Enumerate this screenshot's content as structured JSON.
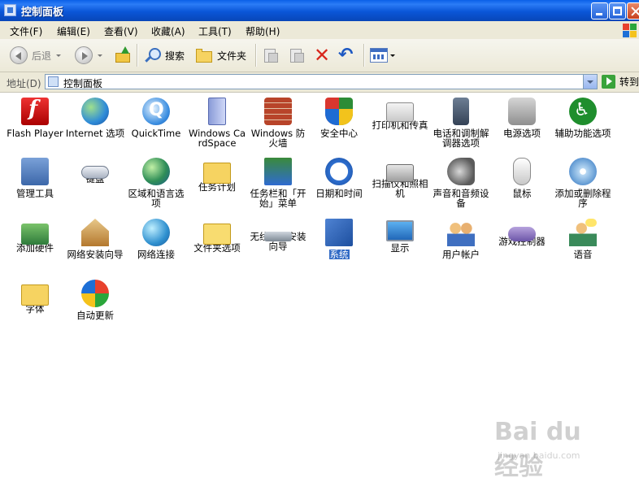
{
  "window": {
    "title": "控制面板"
  },
  "menu": [
    "文件(F)",
    "编辑(E)",
    "查看(V)",
    "收藏(A)",
    "工具(T)",
    "帮助(H)"
  ],
  "toolbar": {
    "back": "后退",
    "search": "搜索",
    "folders": "文件夹"
  },
  "address": {
    "label": "地址(D)",
    "value": "控制面板",
    "go": "转到"
  },
  "items": [
    {
      "label": "Flash Player",
      "icon": "flash-player-icon"
    },
    {
      "label": "Internet 选项",
      "icon": "internet-options-icon"
    },
    {
      "label": "QuickTime",
      "icon": "quicktime-icon"
    },
    {
      "label": "Windows CardSpace",
      "icon": "cardspace-icon"
    },
    {
      "label": "Windows 防火墙",
      "icon": "firewall-icon"
    },
    {
      "label": "安全中心",
      "icon": "security-center-icon"
    },
    {
      "label": "打印机和传真",
      "icon": "printer-icon"
    },
    {
      "label": "电话和调制解调器选项",
      "icon": "phone-modem-icon"
    },
    {
      "label": "电源选项",
      "icon": "power-icon"
    },
    {
      "label": "辅助功能选项",
      "icon": "accessibility-icon"
    },
    {
      "label": "管理工具",
      "icon": "admin-tools-icon"
    },
    {
      "label": "键盘",
      "icon": "keyboard-icon"
    },
    {
      "label": "区域和语言选项",
      "icon": "region-language-icon"
    },
    {
      "label": "任务计划",
      "icon": "scheduled-tasks-icon"
    },
    {
      "label": "任务栏和「开始」菜单",
      "icon": "taskbar-start-icon"
    },
    {
      "label": "日期和时间",
      "icon": "date-time-icon"
    },
    {
      "label": "扫描仪和照相机",
      "icon": "scanner-camera-icon"
    },
    {
      "label": "声音和音频设备",
      "icon": "sound-icon"
    },
    {
      "label": "鼠标",
      "icon": "mouse-icon"
    },
    {
      "label": "添加或删除程序",
      "icon": "add-remove-programs-icon"
    },
    {
      "label": "添加硬件",
      "icon": "add-hardware-icon"
    },
    {
      "label": "网络安装向导",
      "icon": "network-setup-icon"
    },
    {
      "label": "网络连接",
      "icon": "network-connections-icon"
    },
    {
      "label": "文件夹选项",
      "icon": "folder-options-icon"
    },
    {
      "label": "无线网络安装向导",
      "icon": "wireless-setup-icon"
    },
    {
      "label": "系统",
      "icon": "system-icon",
      "selected": true
    },
    {
      "label": "显示",
      "icon": "display-icon"
    },
    {
      "label": "用户帐户",
      "icon": "user-accounts-icon"
    },
    {
      "label": "游戏控制器",
      "icon": "game-controller-icon"
    },
    {
      "label": "语音",
      "icon": "speech-icon"
    },
    {
      "label": "字体",
      "icon": "fonts-icon"
    },
    {
      "label": "自动更新",
      "icon": "automatic-updates-icon"
    }
  ],
  "watermark": {
    "main": "Bai du 经验",
    "sub": "jingyan.baidu.com"
  }
}
